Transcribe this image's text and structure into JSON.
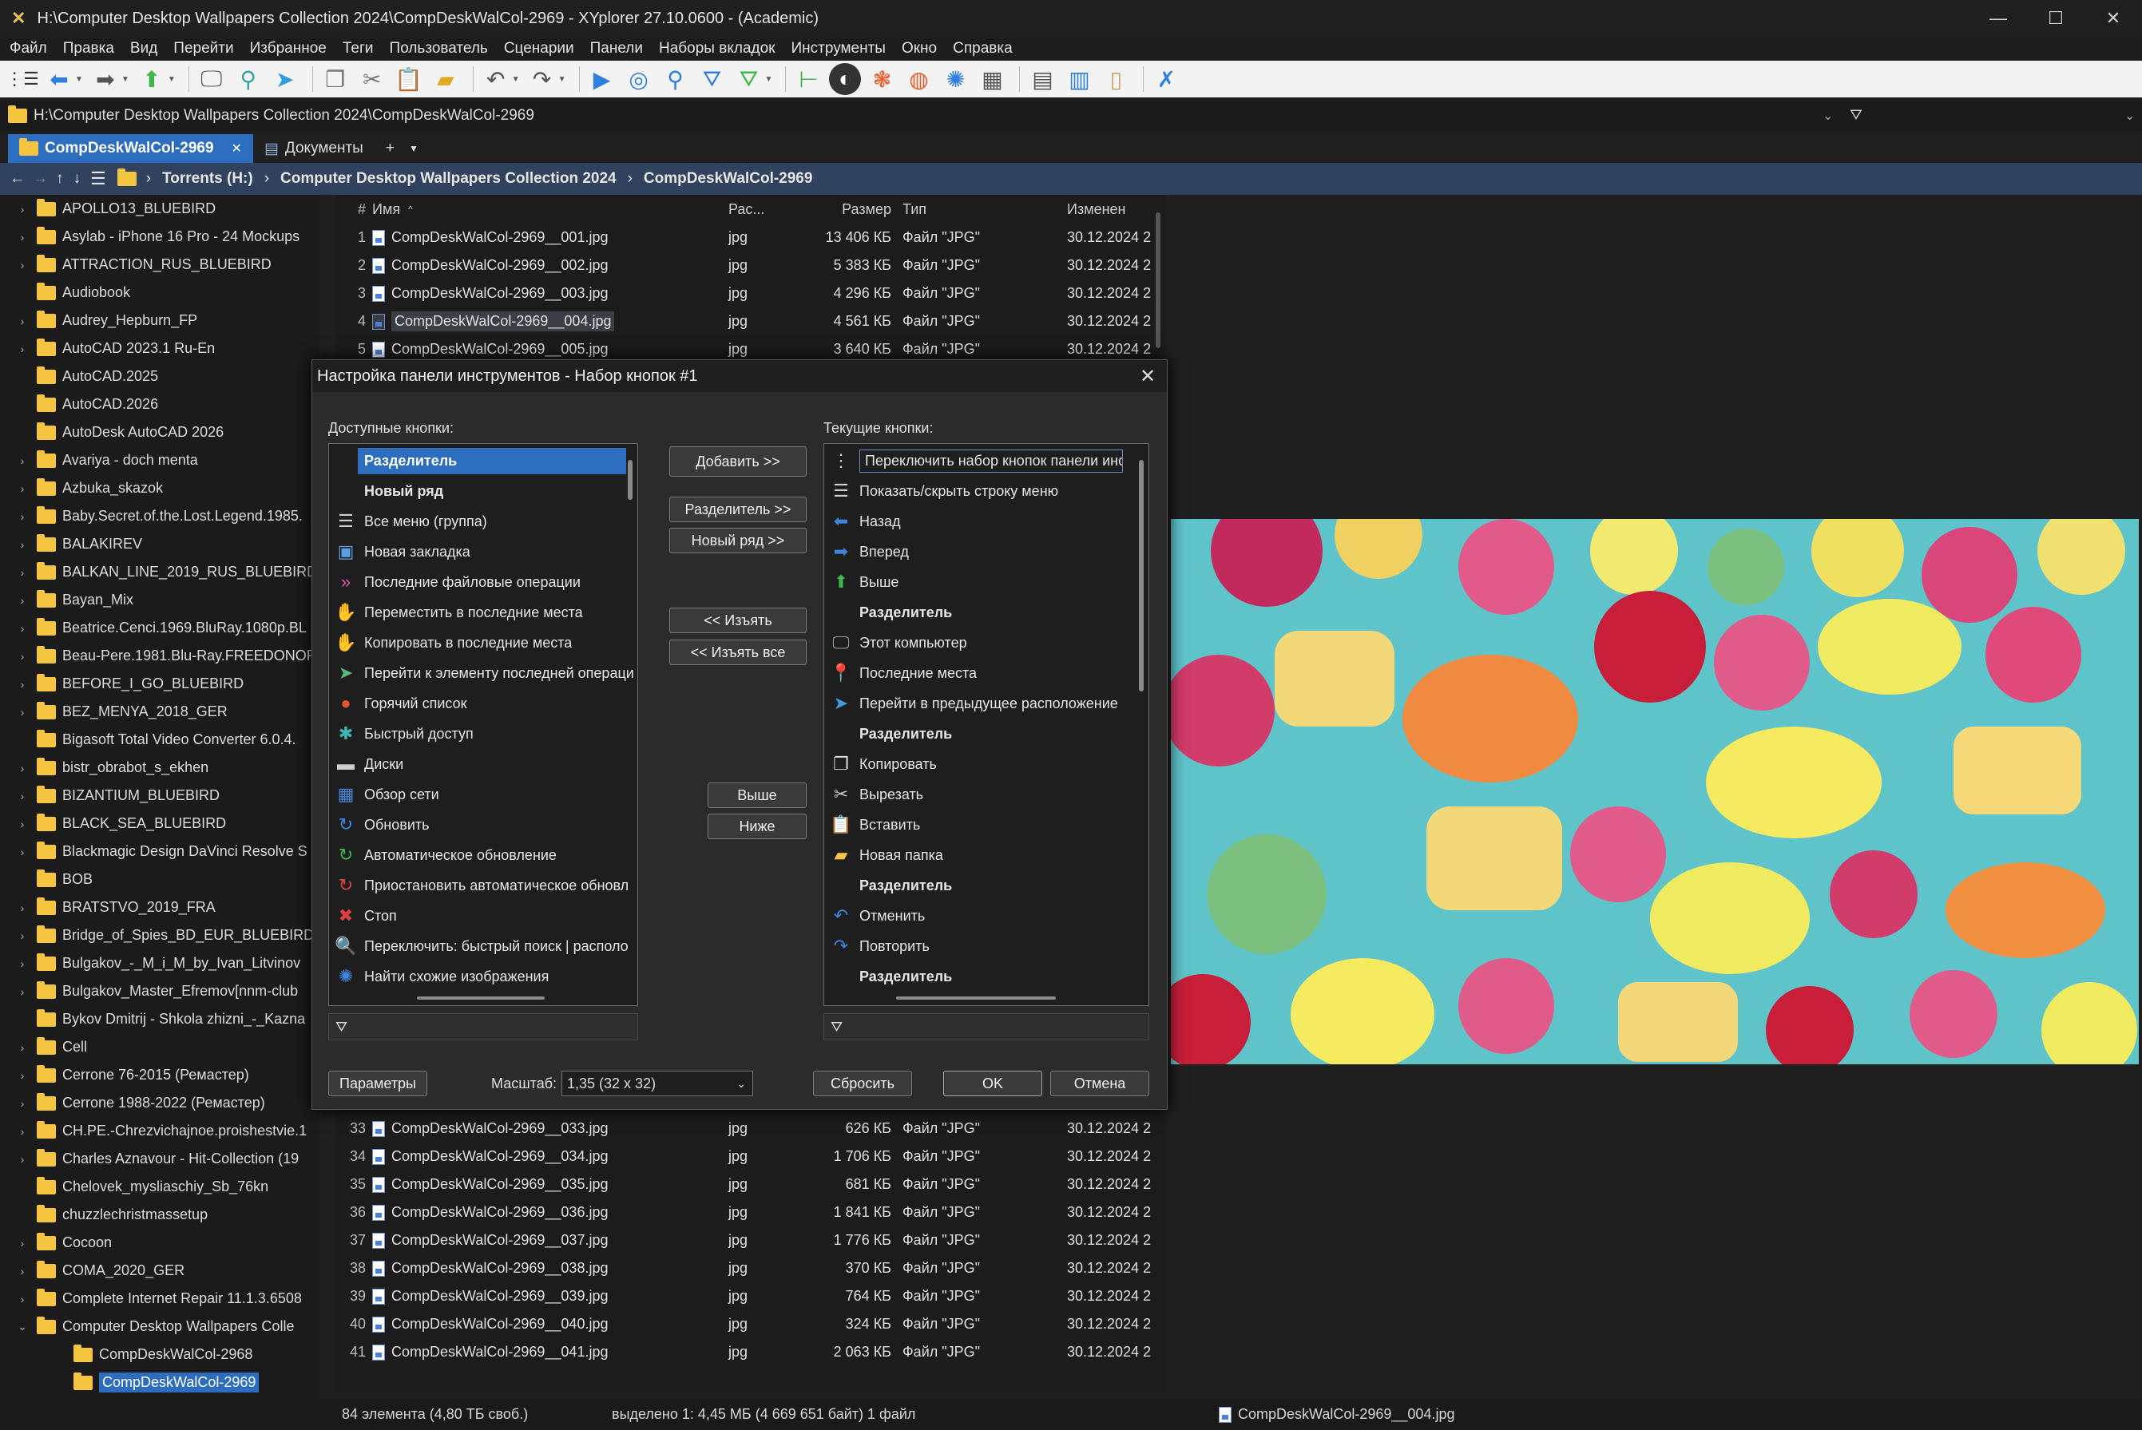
{
  "window": {
    "title": "H:\\Computer Desktop Wallpapers Collection 2024\\CompDeskWalCol-2969 - XYplorer 27.10.0600 - (Academic)"
  },
  "menu": [
    "Файл",
    "Правка",
    "Вид",
    "Перейти",
    "Избранное",
    "Теги",
    "Пользователь",
    "Сценарии",
    "Панели",
    "Наборы вкладок",
    "Инструменты",
    "Окно",
    "Справка"
  ],
  "address": {
    "path": "H:\\Computer Desktop Wallpapers Collection 2024\\CompDeskWalCol-2969"
  },
  "tabs": [
    {
      "label": "CompDeskWalCol-2969",
      "active": true
    },
    {
      "label": "Документы",
      "active": false
    }
  ],
  "breadcrumb": [
    "Torrents (H:)",
    "Computer Desktop Wallpapers Collection 2024",
    "CompDeskWalCol-2969"
  ],
  "tree": [
    {
      "label": "APOLLO13_BLUEBIRD",
      "arrow": true
    },
    {
      "label": "Asylab - iPhone 16 Pro - 24 Mockups",
      "arrow": true
    },
    {
      "label": "ATTRACTION_RUS_BLUEBIRD",
      "arrow": true
    },
    {
      "label": "Audiobook",
      "arrow": false
    },
    {
      "label": "Audrey_Hepburn_FP",
      "arrow": true
    },
    {
      "label": "AutoCAD 2023.1 Ru-En",
      "arrow": true
    },
    {
      "label": "AutoCAD.2025",
      "arrow": false
    },
    {
      "label": "AutoCAD.2026",
      "arrow": false
    },
    {
      "label": "AutoDesk AutoCAD 2026",
      "arrow": false
    },
    {
      "label": "Avariya - doch menta",
      "arrow": true
    },
    {
      "label": "Azbuka_skazok",
      "arrow": true
    },
    {
      "label": "Baby.Secret.of.the.Lost.Legend.1985.",
      "arrow": true
    },
    {
      "label": "BALAKIREV",
      "arrow": true
    },
    {
      "label": "BALKAN_LINE_2019_RUS_BLUEBIRD",
      "arrow": true
    },
    {
      "label": "Bayan_Mix",
      "arrow": true
    },
    {
      "label": "Beatrice.Cenci.1969.BluRay.1080p.BL",
      "arrow": true
    },
    {
      "label": "Beau-Pere.1981.Blu-Ray.FREEDONOR",
      "arrow": true
    },
    {
      "label": "BEFORE_I_GO_BLUEBIRD",
      "arrow": true
    },
    {
      "label": "BEZ_MENYA_2018_GER",
      "arrow": true
    },
    {
      "label": "Bigasoft Total Video Converter 6.0.4.",
      "arrow": false
    },
    {
      "label": "bistr_obrabot_s_ekhen",
      "arrow": true
    },
    {
      "label": "BIZANTIUM_BLUEBIRD",
      "arrow": true
    },
    {
      "label": "BLACK_SEA_BLUEBIRD",
      "arrow": true
    },
    {
      "label": "Blackmagic Design DaVinci Resolve S",
      "arrow": true
    },
    {
      "label": "BOB",
      "arrow": false
    },
    {
      "label": "BRATSTVO_2019_FRA",
      "arrow": true
    },
    {
      "label": "Bridge_of_Spies_BD_EUR_BLUEBIRD",
      "arrow": true
    },
    {
      "label": "Bulgakov_-_M_i_M_by_Ivan_Litvinov",
      "arrow": true
    },
    {
      "label": "Bulgakov_Master_Efremov[nnm-club",
      "arrow": true
    },
    {
      "label": "Bykov Dmitrij - Shkola zhizni_-_Kazna",
      "arrow": false
    },
    {
      "label": "Cell",
      "arrow": true
    },
    {
      "label": "Cerrone 76-2015 (Ремастер)",
      "arrow": true
    },
    {
      "label": "Cerrone 1988-2022 (Ремастер)",
      "arrow": true
    },
    {
      "label": "CH.PE.-Chrezvichajnoe.proishestvie.1",
      "arrow": true
    },
    {
      "label": "Charles Aznavour - Hit-Collection (19",
      "arrow": true
    },
    {
      "label": "Chelovek_mysliaschiy_Sb_76kn",
      "arrow": false
    },
    {
      "label": "chuzzlechristmassetup",
      "arrow": false
    },
    {
      "label": "Cocoon",
      "arrow": true
    },
    {
      "label": "COMA_2020_GER",
      "arrow": true
    },
    {
      "label": "Complete Internet Repair 11.1.3.6508",
      "arrow": true
    },
    {
      "label": "Computer Desktop Wallpapers Colle",
      "arrow": "open"
    },
    {
      "label": "CompDeskWalCol-2968",
      "arrow": false,
      "indent": true
    },
    {
      "label": "CompDeskWalCol-2969",
      "arrow": false,
      "indent": true,
      "selected": true
    }
  ],
  "columns": {
    "num": "#",
    "name": "Имя",
    "ext": "Рас...",
    "size": "Размер",
    "type": "Тип",
    "date": "Изменен"
  },
  "files_top": [
    {
      "n": "1",
      "name": "CompDeskWalCol-2969__001.jpg",
      "ext": "jpg",
      "size": "13 406 КБ",
      "type": "Файл \"JPG\"",
      "date": "30.12.2024 2"
    },
    {
      "n": "2",
      "name": "CompDeskWalCol-2969__002.jpg",
      "ext": "jpg",
      "size": "5 383 КБ",
      "type": "Файл \"JPG\"",
      "date": "30.12.2024 2"
    },
    {
      "n": "3",
      "name": "CompDeskWalCol-2969__003.jpg",
      "ext": "jpg",
      "size": "4 296 КБ",
      "type": "Файл \"JPG\"",
      "date": "30.12.2024 2"
    },
    {
      "n": "4",
      "name": "CompDeskWalCol-2969__004.jpg",
      "ext": "jpg",
      "size": "4 561 КБ",
      "type": "Файл \"JPG\"",
      "date": "30.12.2024 2",
      "hl": true
    },
    {
      "n": "5",
      "name": "CompDeskWalCol-2969__005.jpg",
      "ext": "jpg",
      "size": "3 640 КБ",
      "type": "Файл \"JPG\"",
      "date": "30.12.2024 2"
    }
  ],
  "files_bottom": [
    {
      "n": "33",
      "name": "CompDeskWalCol-2969__033.jpg",
      "ext": "jpg",
      "size": "626 КБ",
      "type": "Файл \"JPG\"",
      "date": "30.12.2024 2"
    },
    {
      "n": "34",
      "name": "CompDeskWalCol-2969__034.jpg",
      "ext": "jpg",
      "size": "1 706 КБ",
      "type": "Файл \"JPG\"",
      "date": "30.12.2024 2"
    },
    {
      "n": "35",
      "name": "CompDeskWalCol-2969__035.jpg",
      "ext": "jpg",
      "size": "681 КБ",
      "type": "Файл \"JPG\"",
      "date": "30.12.2024 2"
    },
    {
      "n": "36",
      "name": "CompDeskWalCol-2969__036.jpg",
      "ext": "jpg",
      "size": "1 841 КБ",
      "type": "Файл \"JPG\"",
      "date": "30.12.2024 2"
    },
    {
      "n": "37",
      "name": "CompDeskWalCol-2969__037.jpg",
      "ext": "jpg",
      "size": "1 776 КБ",
      "type": "Файл \"JPG\"",
      "date": "30.12.2024 2"
    },
    {
      "n": "38",
      "name": "CompDeskWalCol-2969__038.jpg",
      "ext": "jpg",
      "size": "370 КБ",
      "type": "Файл \"JPG\"",
      "date": "30.12.2024 2"
    },
    {
      "n": "39",
      "name": "CompDeskWalCol-2969__039.jpg",
      "ext": "jpg",
      "size": "764 КБ",
      "type": "Файл \"JPG\"",
      "date": "30.12.2024 2"
    },
    {
      "n": "40",
      "name": "CompDeskWalCol-2969__040.jpg",
      "ext": "jpg",
      "size": "324 КБ",
      "type": "Файл \"JPG\"",
      "date": "30.12.2024 2"
    },
    {
      "n": "41",
      "name": "CompDeskWalCol-2969__041.jpg",
      "ext": "jpg",
      "size": "2 063 КБ",
      "type": "Файл \"JPG\"",
      "date": "30.12.2024 2"
    }
  ],
  "status": {
    "count": "84 элемента (4,80 ТБ своб.)",
    "selected": "выделено 1: 4,45 МБ (4 669 651 байт) 1 файл",
    "file": "CompDeskWalCol-2969__004.jpg"
  },
  "dialog": {
    "title": "Настройка панели инструментов - Набор кнопок #1",
    "available_label": "Доступные кнопки:",
    "current_label": "Текущие кнопки:",
    "available": [
      {
        "label": "Разделитель",
        "icon": "none",
        "bold": true,
        "selected": true
      },
      {
        "label": "Новый ряд",
        "icon": "none",
        "bold": true
      },
      {
        "label": "Все меню (группа)",
        "icon": "menu",
        "glyph": "☰",
        "color": "#cfcfcf"
      },
      {
        "label": "Новая закладка",
        "icon": "new-tab",
        "glyph": "▣",
        "color": "#5aa0e6"
      },
      {
        "label": "Последние файловые операции",
        "icon": "recent-ops",
        "glyph": "»",
        "color": "#e05aa8"
      },
      {
        "label": "Переместить в последние места",
        "icon": "move-recent",
        "glyph": "✋",
        "color": "#b57b4a"
      },
      {
        "label": "Копировать в последние места",
        "icon": "copy-recent",
        "glyph": "✋",
        "color": "#4a86d9"
      },
      {
        "label": "Перейти к элементу последней операци",
        "icon": "goto-last",
        "glyph": "➤",
        "color": "#5ab87a"
      },
      {
        "label": "Горячий список",
        "icon": "hotlist",
        "glyph": "●",
        "color": "#e8522f"
      },
      {
        "label": "Быстрый доступ",
        "icon": "quick-access",
        "glyph": "✱",
        "color": "#3fb6b0"
      },
      {
        "label": "Диски",
        "icon": "drives",
        "glyph": "▬",
        "color": "#d0d0d0"
      },
      {
        "label": "Обзор сети",
        "icon": "network",
        "glyph": "▦",
        "color": "#4a86d9"
      },
      {
        "label": "Обновить",
        "icon": "refresh",
        "glyph": "↻",
        "color": "#3a86e0"
      },
      {
        "label": "Автоматическое обновление",
        "icon": "auto-refresh",
        "glyph": "↻",
        "color": "#3ab84a"
      },
      {
        "label": "Приостановить автоматическое обновл",
        "icon": "pause-refresh",
        "glyph": "↻",
        "color": "#e04040"
      },
      {
        "label": "Стоп",
        "icon": "stop",
        "glyph": "✖",
        "color": "#e04040"
      },
      {
        "label": "Переключить: быстрый поиск | располо",
        "icon": "quick-search",
        "glyph": "🔍",
        "color": "#3ab84a"
      },
      {
        "label": "Найти схожие изображения",
        "icon": "similar-images",
        "glyph": "✺",
        "color": "#3a86e0"
      }
    ],
    "current": [
      {
        "label": "Переключить набор кнопок панели инс",
        "icon": "toggle-set",
        "glyph": "⋮",
        "color": "#d0d0d0",
        "boxed": true
      },
      {
        "label": "Показать/скрыть строку меню",
        "icon": "menu",
        "glyph": "☰",
        "color": "#d0d0d0"
      },
      {
        "label": "Назад",
        "icon": "back-arrow",
        "glyph": "⬅",
        "color": "#3a86e0"
      },
      {
        "label": "Вперед",
        "icon": "forward-arrow",
        "glyph": "➡",
        "color": "#3a86e0"
      },
      {
        "label": "Выше",
        "icon": "up-arrow",
        "glyph": "⬆",
        "color": "#3ab84a"
      },
      {
        "label": "Разделитель",
        "icon": "none",
        "bold": true
      },
      {
        "label": "Этот компьютер",
        "icon": "computer",
        "glyph": "🖵",
        "color": "#a0a0a0"
      },
      {
        "label": "Последние места",
        "icon": "location-pin",
        "glyph": "📍",
        "color": "#3ab8a0"
      },
      {
        "label": "Перейти в предыдущее расположение",
        "icon": "goto-previous",
        "glyph": "➤",
        "color": "#3a9ee0"
      },
      {
        "label": "Разделитель",
        "icon": "none",
        "bold": true
      },
      {
        "label": "Копировать",
        "icon": "copy",
        "glyph": "❐",
        "color": "#e0e0e0"
      },
      {
        "label": "Вырезать",
        "icon": "cut",
        "glyph": "✂",
        "color": "#c8c8c8"
      },
      {
        "label": "Вставить",
        "icon": "paste",
        "glyph": "📋",
        "color": "#c8c8c8"
      },
      {
        "label": "Новая папка",
        "icon": "new-folder",
        "glyph": "▰",
        "color": "#f5c542"
      },
      {
        "label": "Разделитель",
        "icon": "none",
        "bold": true
      },
      {
        "label": "Отменить",
        "icon": "undo",
        "glyph": "↶",
        "color": "#3a86e0"
      },
      {
        "label": "Повторить",
        "icon": "redo",
        "glyph": "↷",
        "color": "#3a86e0"
      },
      {
        "label": "Разделитель",
        "icon": "none",
        "bold": true
      }
    ],
    "buttons": {
      "add": "Добавить >>",
      "separator": "Разделитель >>",
      "new_row": "Новый ряд >>",
      "remove": "<< Изъять",
      "remove_all": "<< Изъять все",
      "up": "Выше",
      "down": "Ниже",
      "params": "Параметры",
      "reset": "Сбросить",
      "ok": "OK",
      "cancel": "Отмена"
    },
    "scale_label": "Масштаб:",
    "scale_value": "1,35   (32 x 32)"
  }
}
